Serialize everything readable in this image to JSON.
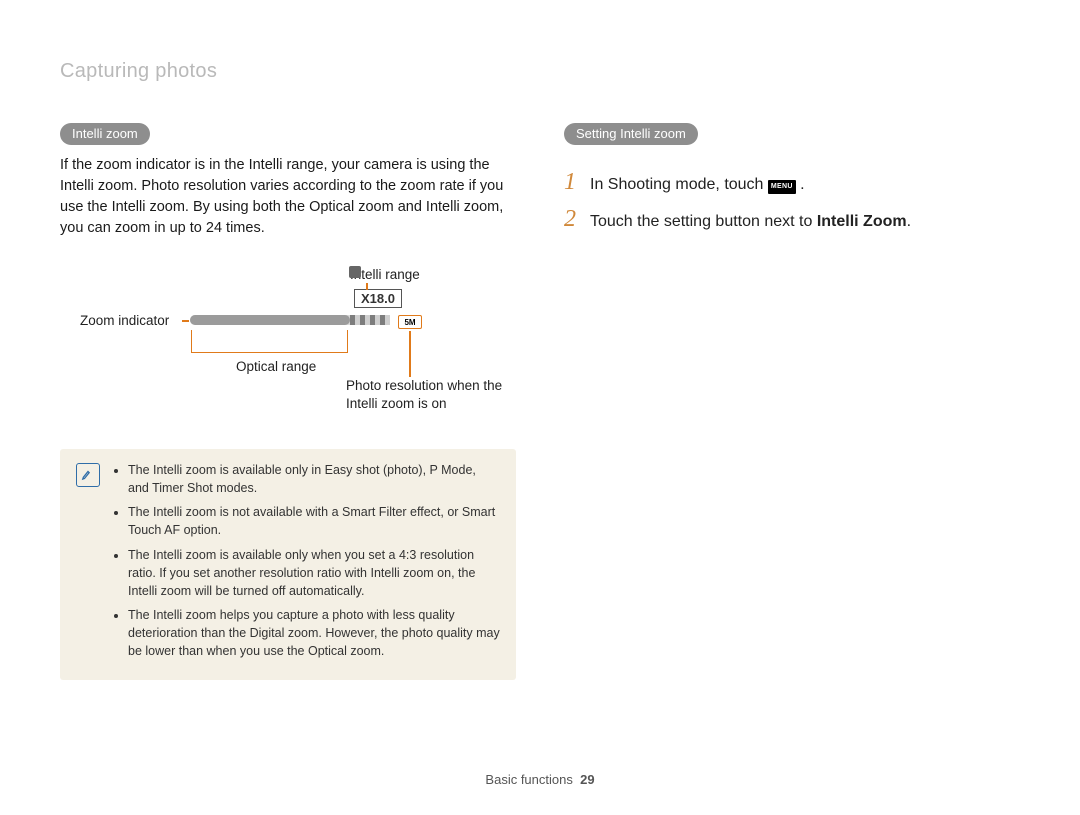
{
  "header": {
    "title": "Capturing photos"
  },
  "left": {
    "pill": "Intelli zoom",
    "paragraph": "If the zoom indicator is in the Intelli range, your camera is using the Intelli zoom. Photo resolution varies according to the zoom rate if you use the Intelli zoom. By using both the Optical zoom and Intelli zoom, you can zoom in up to 24 times.",
    "diagram": {
      "intelli_range_label": "Intelli range",
      "zoom_indicator_label": "Zoom indicator",
      "optical_range_label": "Optical range",
      "photo_res_label": "Photo resolution when the Intelli zoom is on",
      "zoom_value": "X18.0",
      "res_icon_text": "5M"
    },
    "note_icon_name": "note-icon",
    "notes": [
      "The Intelli zoom is available only in Easy shot (photo), P Mode, and Timer Shot modes.",
      "The Intelli zoom is not available with a Smart Filter effect, or Smart Touch AF option.",
      "The Intelli zoom is available only when you set a 4:3 resolution ratio. If you set another resolution ratio with Intelli zoom on, the Intelli zoom will be turned off automatically.",
      "The Intelli zoom helps you capture a photo with less quality deterioration than the Digital zoom. However, the photo quality may be lower than when you use the Optical zoom."
    ]
  },
  "right": {
    "pill": "Setting Intelli zoom",
    "steps": [
      {
        "num": "1",
        "pre": "In Shooting mode, touch ",
        "icon": "MENU",
        "post": " ."
      },
      {
        "num": "2",
        "pre": "Touch the setting button next to ",
        "bold": "Intelli Zoom",
        "post": "."
      }
    ]
  },
  "footer": {
    "section": "Basic functions",
    "page": "29"
  }
}
